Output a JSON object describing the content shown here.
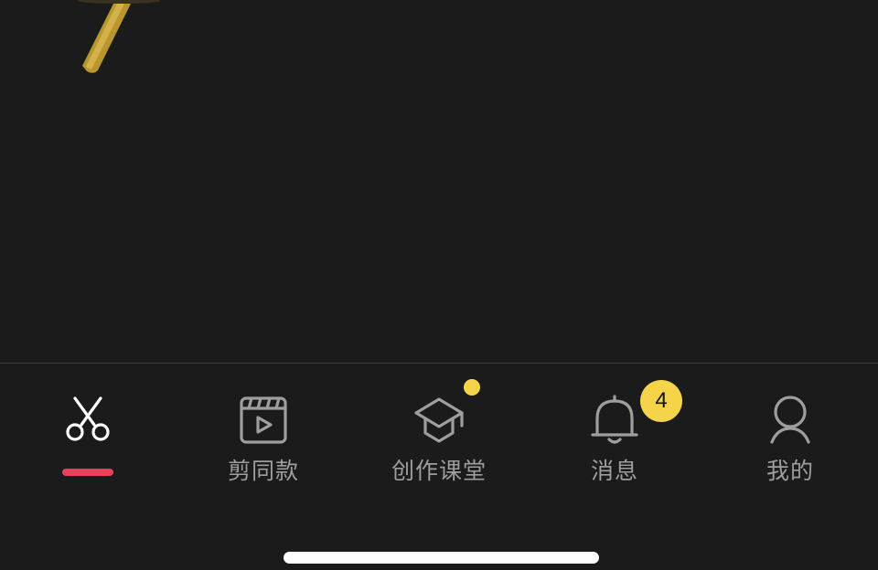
{
  "colors": {
    "background": "#1b1b1b",
    "active_icon": "#ffffff",
    "inactive_icon": "#9e9e9e",
    "active_indicator": "#e4415a",
    "badge": "#f5d44a"
  },
  "tabs": [
    {
      "id": "edit",
      "icon": "scissors-icon",
      "label": "",
      "active": true
    },
    {
      "id": "templates",
      "icon": "video-template-icon",
      "label": "剪同款",
      "active": false
    },
    {
      "id": "classroom",
      "icon": "graduation-cap-icon",
      "label": "创作课堂",
      "active": false,
      "dot_badge": true
    },
    {
      "id": "messages",
      "icon": "bell-icon",
      "label": "消息",
      "active": false,
      "badge_count": "4"
    },
    {
      "id": "profile",
      "icon": "user-icon",
      "label": "我的",
      "active": false
    }
  ]
}
